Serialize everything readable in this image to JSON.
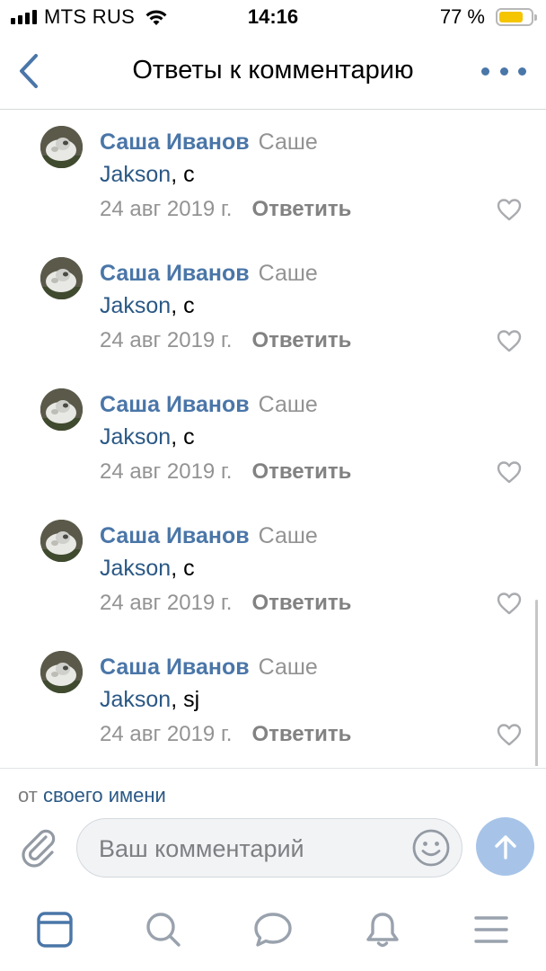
{
  "status_bar": {
    "carrier": "MTS RUS",
    "time": "14:16",
    "battery_percent": "77 %",
    "battery_level": 0.77,
    "icons": [
      "signal-icon",
      "wifi-icon",
      "battery-icon"
    ]
  },
  "nav": {
    "title": "Ответы к комментарию",
    "back_icon": "chevron-left-icon",
    "more_icon": "more-dots-icon"
  },
  "comments": [
    {
      "author": "Саша Иванов",
      "reply_to": "Саше",
      "mention": "Jakson",
      "text": ", c",
      "date": "24 авг 2019 г.",
      "reply_label": "Ответить"
    },
    {
      "author": "Саша Иванов",
      "reply_to": "Саше",
      "mention": "Jakson",
      "text": ", c",
      "date": "24 авг 2019 г.",
      "reply_label": "Ответить"
    },
    {
      "author": "Саша Иванов",
      "reply_to": "Саше",
      "mention": "Jakson",
      "text": ", c",
      "date": "24 авг 2019 г.",
      "reply_label": "Ответить"
    },
    {
      "author": "Саша Иванов",
      "reply_to": "Саше",
      "mention": "Jakson",
      "text": ", c",
      "date": "24 авг 2019 г.",
      "reply_label": "Ответить"
    },
    {
      "author": "Саша Иванов",
      "reply_to": "Саше",
      "mention": "Jakson",
      "text": ", sj",
      "date": "24 авг 2019 г.",
      "reply_label": "Ответить"
    }
  ],
  "composer": {
    "as_prefix": "от",
    "as_link": "своего имени",
    "placeholder": "Ваш комментарий",
    "value": "",
    "icons": [
      "paperclip-icon",
      "smiley-icon",
      "send-arrow-icon"
    ]
  },
  "tab_bar": {
    "items": [
      "news-feed-icon",
      "search-icon",
      "messages-icon",
      "notifications-icon",
      "menu-icon"
    ],
    "active": "news-feed-icon"
  },
  "colors": {
    "accent": "#4a76a8",
    "link": "#2a5885",
    "secondary_text": "#939393",
    "send_button": "#a7c4e8",
    "battery_fill": "#f4c500"
  }
}
